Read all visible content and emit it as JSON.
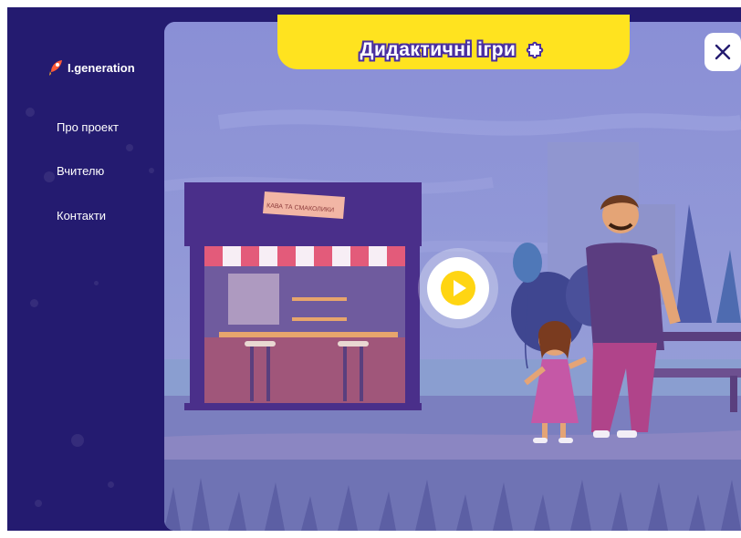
{
  "sidebar": {
    "logo_text": "I.generation",
    "nav": [
      {
        "label": "Про проект"
      },
      {
        "label": "Вчителю"
      },
      {
        "label": "Контакти"
      }
    ]
  },
  "header": {
    "title": "Дидактичні ігри"
  },
  "scene": {
    "kiosk_sign": "КАВА ТА СМАКОЛИКИ"
  },
  "icons": {
    "close": "close-icon",
    "play": "play-icon",
    "title_badge": "puzzle-icon",
    "logo": "rocket-icon"
  },
  "colors": {
    "sidebar_bg": "#241b70",
    "title_bar": "#ffe31f",
    "play_accent": "#ffd512",
    "scene_sky": "#7f85cc"
  }
}
